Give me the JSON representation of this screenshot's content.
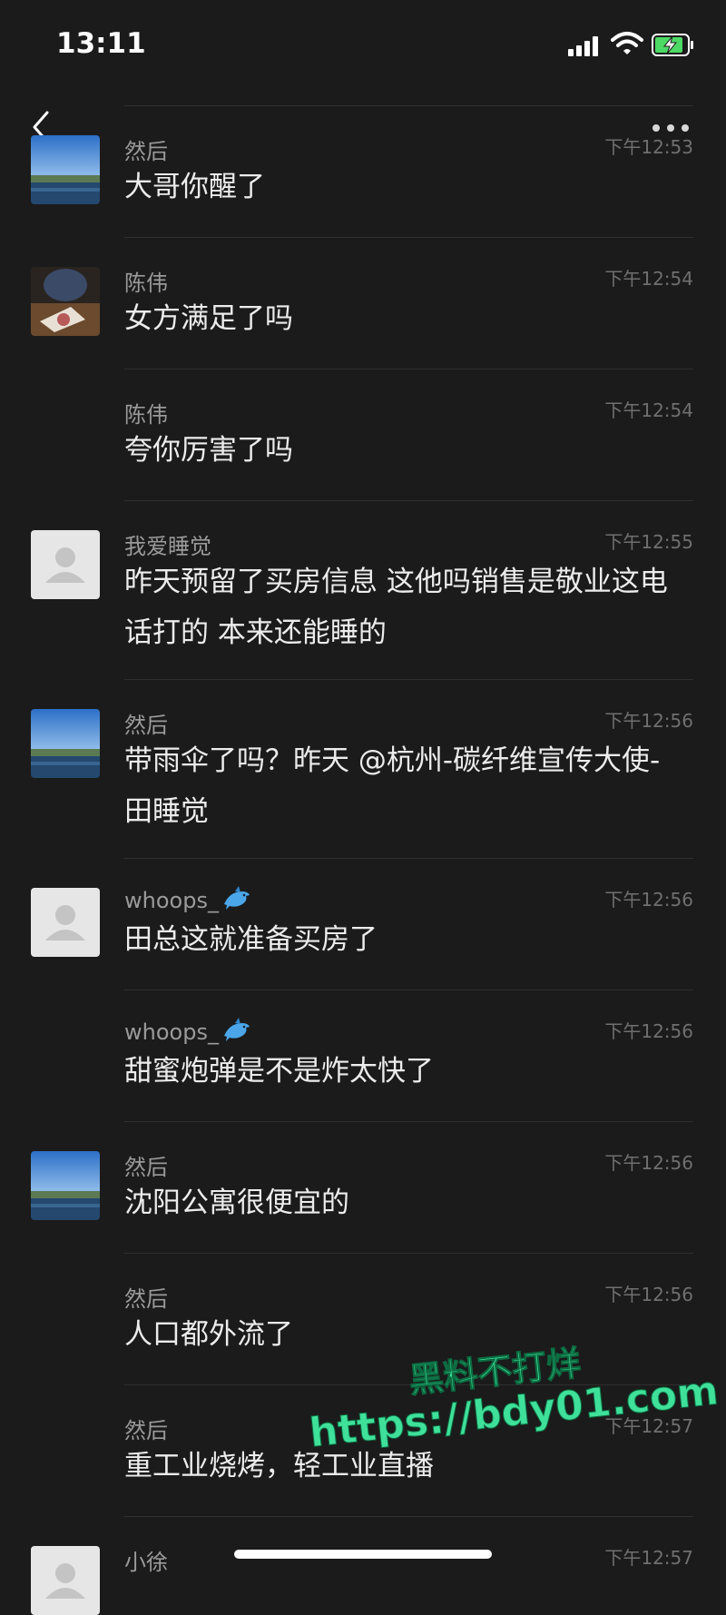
{
  "status_bar": {
    "time": "13:11"
  },
  "header": {
    "back_icon": "chevron-left-icon",
    "more_icon": "more-dots-icon"
  },
  "messages": [
    {
      "name": "然后",
      "time": "下午12:53",
      "text": "大哥你醒了",
      "avatar": "landscape"
    },
    {
      "name": "陈伟",
      "time": "下午12:54",
      "text": "女方满足了吗",
      "avatar": "photo-table"
    },
    {
      "name": "陈伟",
      "time": "下午12:54",
      "text": "夸你厉害了吗",
      "avatar": "none"
    },
    {
      "name": "我爱睡觉",
      "time": "下午12:55",
      "text": "昨天预留了买房信息 这他吗销售是敬业这电话打的 本来还能睡的",
      "avatar": "default"
    },
    {
      "name": "然后",
      "time": "下午12:56",
      "text": "带雨伞了吗？昨天 @杭州-碳纤维宣传大使-田睡觉",
      "avatar": "landscape"
    },
    {
      "name": "whoops_",
      "time": "下午12:56",
      "text": "田总这就准备买房了",
      "avatar": "default",
      "emoji": "dolphin-icon"
    },
    {
      "name": "whoops_",
      "time": "下午12:56",
      "text": "甜蜜炮弹是不是炸太快了",
      "avatar": "none",
      "emoji": "dolphin-icon"
    },
    {
      "name": "然后",
      "time": "下午12:56",
      "text": "沈阳公寓很便宜的",
      "avatar": "landscape"
    },
    {
      "name": "然后",
      "time": "下午12:56",
      "text": "人口都外流了",
      "avatar": "none"
    },
    {
      "name": "然后",
      "time": "下午12:57",
      "text": "重工业烧烤，轻工业直播",
      "avatar": "none"
    },
    {
      "name": "小徐",
      "time": "下午12:57",
      "text": "",
      "avatar": "default"
    }
  ],
  "watermark": {
    "line1": "黑料不打烊",
    "line2": "https://bdy01.com"
  },
  "colors": {
    "background": "#1b1b1b",
    "watermark": "#3fe09a"
  }
}
